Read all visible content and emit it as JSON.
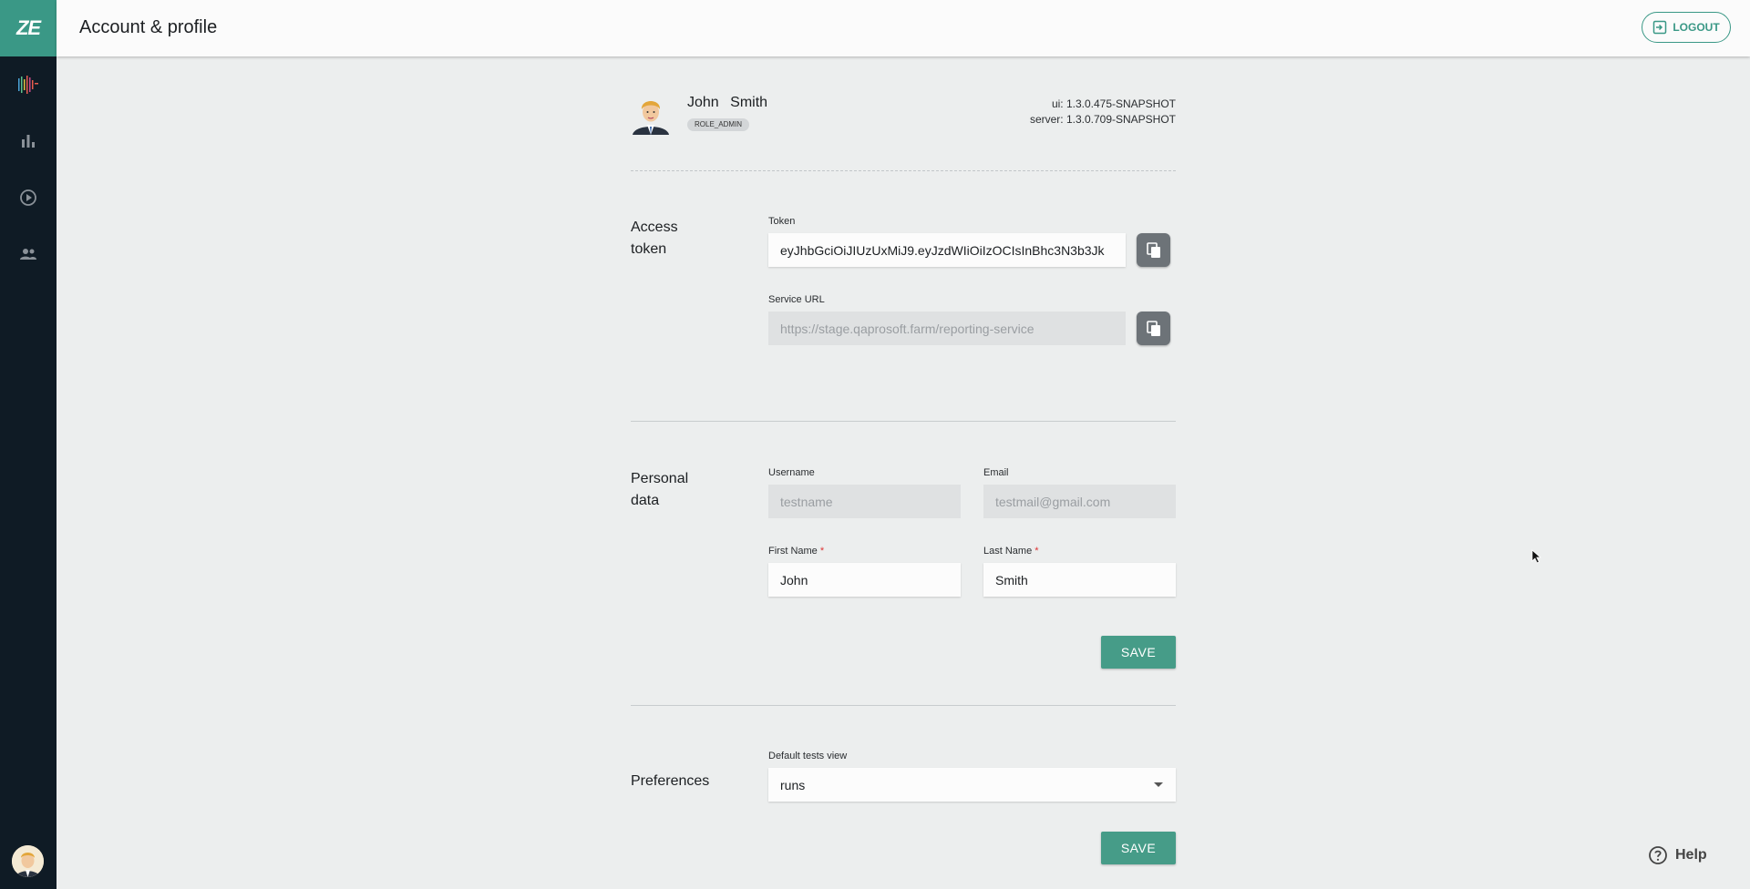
{
  "header": {
    "title": "Account & profile",
    "logout_label": "LOGOUT"
  },
  "sidebar": {
    "logo": "ZE",
    "items": [
      {
        "icon": "colorful-bars-icon"
      },
      {
        "icon": "bar-chart-icon"
      },
      {
        "icon": "play-circle-icon"
      },
      {
        "icon": "people-icon"
      }
    ],
    "avatar_icon": "user-avatar-icon"
  },
  "profile": {
    "first_name": "John",
    "last_name": "Smith",
    "full_name": "John Smith",
    "role": "ROLE_ADMIN",
    "ui_version": "ui: 1.3.0.475-SNAPSHOT",
    "server_version": "server: 1.3.0.709-SNAPSHOT"
  },
  "access_token": {
    "section_line1": "Access",
    "section_line2": "token",
    "token_label": "Token",
    "token_value": "eyJhbGciOiJIUzUxMiJ9.eyJzdWIiOiIzOCIsInBhc3N3b3Jk",
    "service_url_label": "Service URL",
    "service_url_value": "https://stage.qaprosoft.farm/reporting-service"
  },
  "personal_data": {
    "section_line1": "Personal",
    "section_line2": "data",
    "username_label": "Username",
    "username_value": "testname",
    "email_label": "Email",
    "email_value": "testmail@gmail.com",
    "first_name_label": "First Name",
    "first_name_value": "John",
    "last_name_label": "Last Name",
    "last_name_value": "Smith",
    "required_mark": "*",
    "save_label": "SAVE"
  },
  "preferences": {
    "section_label": "Preferences",
    "default_view_label": "Default tests view",
    "default_view_value": "runs",
    "save_label": "SAVE"
  },
  "help": {
    "label": "Help"
  },
  "colors": {
    "accent": "#3a9886",
    "sidebar": "#0f1b25",
    "save_button": "#469c88"
  }
}
